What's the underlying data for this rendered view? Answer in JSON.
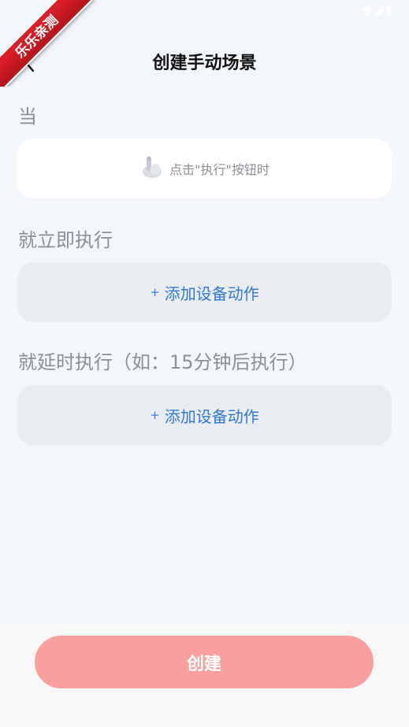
{
  "watermark": "乐乐亲测",
  "header": {
    "title": "创建手动场景"
  },
  "when": {
    "label": "当",
    "trigger_text": "点击\"执行\"按钮时"
  },
  "immediate": {
    "label": "就立即执行",
    "add_text": "添加设备动作",
    "plus": "+"
  },
  "delayed": {
    "label": "就延时执行（如：15分钟后执行）",
    "add_text": "添加设备动作",
    "plus": "+"
  },
  "footer": {
    "create_label": "创建"
  },
  "colors": {
    "accent": "#2f78d4",
    "create_button": "#f9a09f",
    "background": "#f3f6fa",
    "ribbon": "#d01a22"
  },
  "icons": {
    "back": "chevron-left-icon",
    "trigger": "hand-tap-icon",
    "wifi": "wifi-icon",
    "signal": "signal-icon",
    "battery": "battery-icon"
  }
}
